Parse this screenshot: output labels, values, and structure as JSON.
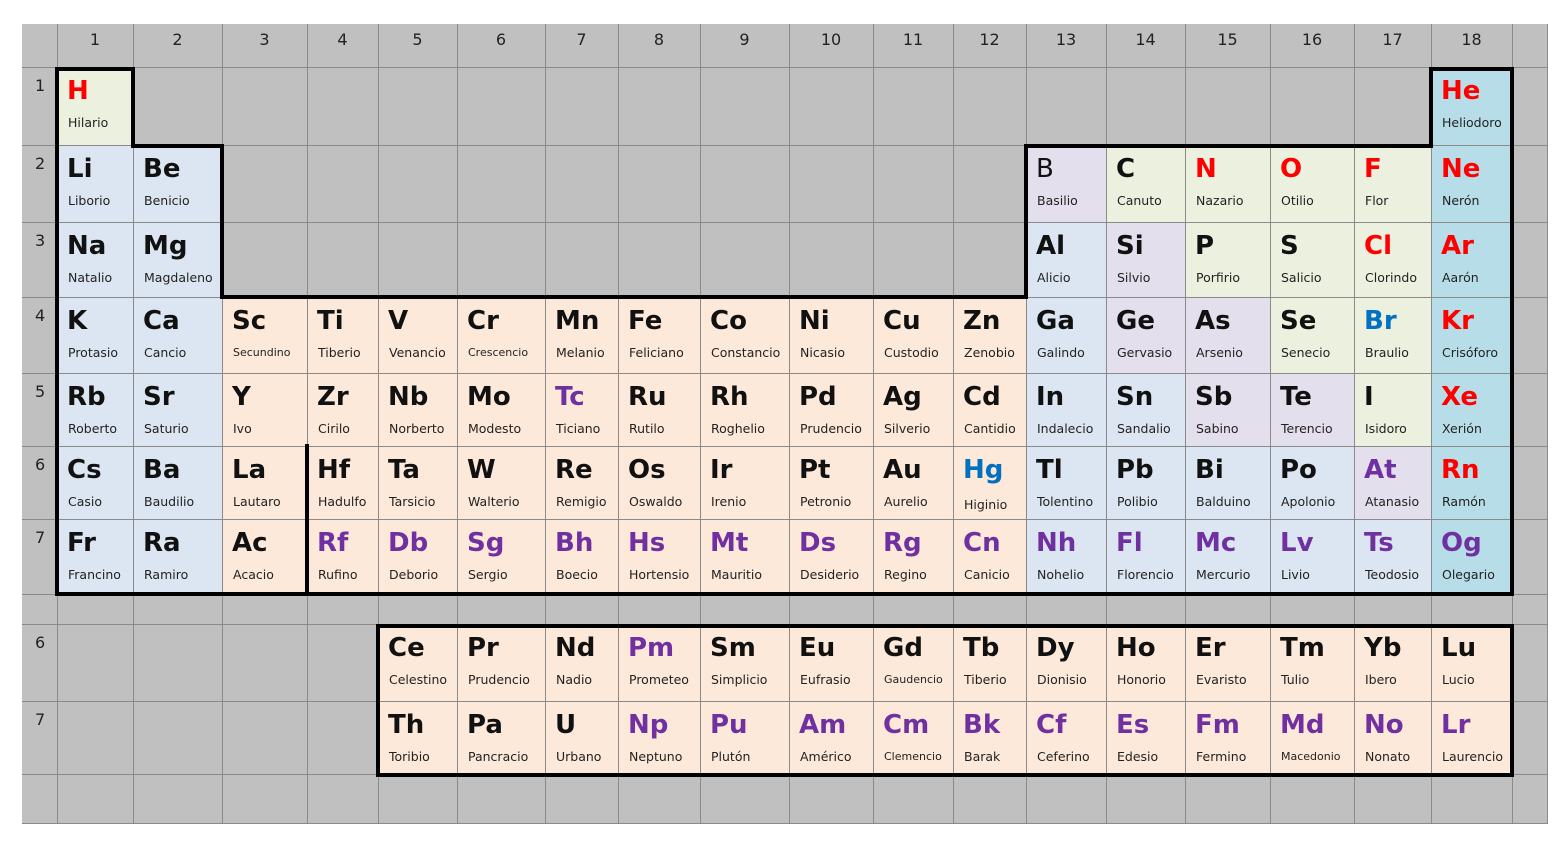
{
  "columns": [
    "1",
    "2",
    "3",
    "4",
    "5",
    "6",
    "7",
    "8",
    "9",
    "10",
    "11",
    "12",
    "13",
    "14",
    "15",
    "16",
    "17",
    "18"
  ],
  "periods": [
    "1",
    "2",
    "3",
    "4",
    "5",
    "6",
    "7"
  ],
  "series_periods": [
    "6",
    "7"
  ],
  "colors": {
    "grid": "#c0c0c0",
    "gridline": "#8a8a8a",
    "alkali": "#dce6f2",
    "transition": "#fde9d9",
    "post_transition": "#dce6f2",
    "metalloid": "#e4dfec",
    "nonmetal": "#ebf1de",
    "noble": "#b7dee8",
    "hydrogen": "#ebf1de",
    "gas_symbol": "#ff0000",
    "liquid_symbol": "#0070c0",
    "synthetic_symbol": "#7030a0"
  },
  "elements": [
    {
      "s": "H",
      "n": "Hilario",
      "r": 1,
      "c": 1,
      "bg": "nonmetal",
      "sc": "gas"
    },
    {
      "s": "He",
      "n": "Heliodoro",
      "r": 1,
      "c": 18,
      "bg": "noble",
      "sc": "gas"
    },
    {
      "s": "Li",
      "n": "Liborio",
      "r": 2,
      "c": 1,
      "bg": "alkali"
    },
    {
      "s": "Be",
      "n": "Benicio",
      "r": 2,
      "c": 2,
      "bg": "alkali"
    },
    {
      "s": "B",
      "n": "Basilio",
      "r": 2,
      "c": 13,
      "bg": "metalloid",
      "thin": true
    },
    {
      "s": "C",
      "n": "Canuto",
      "r": 2,
      "c": 14,
      "bg": "nonmetal"
    },
    {
      "s": "N",
      "n": "Nazario",
      "r": 2,
      "c": 15,
      "bg": "nonmetal",
      "sc": "gas"
    },
    {
      "s": "O",
      "n": "Otilio",
      "r": 2,
      "c": 16,
      "bg": "nonmetal",
      "sc": "gas"
    },
    {
      "s": "F",
      "n": "Flor",
      "r": 2,
      "c": 17,
      "bg": "nonmetal",
      "sc": "gas"
    },
    {
      "s": "Ne",
      "n": "Nerón",
      "r": 2,
      "c": 18,
      "bg": "noble",
      "sc": "gas"
    },
    {
      "s": "Na",
      "n": "Natalio",
      "r": 3,
      "c": 1,
      "bg": "alkali"
    },
    {
      "s": "Mg",
      "n": "Magdaleno",
      "r": 3,
      "c": 2,
      "bg": "alkali"
    },
    {
      "s": "Al",
      "n": "Alicio",
      "r": 3,
      "c": 13,
      "bg": "post_transition"
    },
    {
      "s": "Si",
      "n": "Silvio",
      "r": 3,
      "c": 14,
      "bg": "metalloid"
    },
    {
      "s": "P",
      "n": "Porfirio",
      "r": 3,
      "c": 15,
      "bg": "nonmetal"
    },
    {
      "s": "S",
      "n": "Salicio",
      "r": 3,
      "c": 16,
      "bg": "nonmetal"
    },
    {
      "s": "Cl",
      "n": "Clorindo",
      "r": 3,
      "c": 17,
      "bg": "nonmetal",
      "sc": "gas"
    },
    {
      "s": "Ar",
      "n": "Aarón",
      "r": 3,
      "c": 18,
      "bg": "noble",
      "sc": "gas"
    },
    {
      "s": "K",
      "n": "Protasio",
      "r": 4,
      "c": 1,
      "bg": "alkali"
    },
    {
      "s": "Ca",
      "n": "Cancio",
      "r": 4,
      "c": 2,
      "bg": "alkali"
    },
    {
      "s": "Sc",
      "n": "Secundino",
      "r": 4,
      "c": 3,
      "bg": "transition",
      "small": true
    },
    {
      "s": "Ti",
      "n": "Tiberio",
      "r": 4,
      "c": 4,
      "bg": "transition"
    },
    {
      "s": "V",
      "n": "Venancio",
      "r": 4,
      "c": 5,
      "bg": "transition"
    },
    {
      "s": "Cr",
      "n": "Crescencio",
      "r": 4,
      "c": 6,
      "bg": "transition",
      "small": true
    },
    {
      "s": "Mn",
      "n": "Melanio",
      "r": 4,
      "c": 7,
      "bg": "transition"
    },
    {
      "s": "Fe",
      "n": "Feliciano",
      "r": 4,
      "c": 8,
      "bg": "transition"
    },
    {
      "s": "Co",
      "n": "Constancio",
      "r": 4,
      "c": 9,
      "bg": "transition"
    },
    {
      "s": "Ni",
      "n": "Nicasio",
      "r": 4,
      "c": 10,
      "bg": "transition"
    },
    {
      "s": "Cu",
      "n": "Custodio",
      "r": 4,
      "c": 11,
      "bg": "transition"
    },
    {
      "s": "Zn",
      "n": "Zenobio",
      "r": 4,
      "c": 12,
      "bg": "transition"
    },
    {
      "s": "Ga",
      "n": "Galindo",
      "r": 4,
      "c": 13,
      "bg": "post_transition"
    },
    {
      "s": "Ge",
      "n": "Gervasio",
      "r": 4,
      "c": 14,
      "bg": "metalloid"
    },
    {
      "s": "As",
      "n": "Arsenio",
      "r": 4,
      "c": 15,
      "bg": "metalloid"
    },
    {
      "s": "Se",
      "n": "Senecio",
      "r": 4,
      "c": 16,
      "bg": "nonmetal"
    },
    {
      "s": "Br",
      "n": "Braulio",
      "r": 4,
      "c": 17,
      "bg": "nonmetal",
      "sc": "liquid"
    },
    {
      "s": "Kr",
      "n": "Crisóforo",
      "r": 4,
      "c": 18,
      "bg": "noble",
      "sc": "gas"
    },
    {
      "s": "Rb",
      "n": "Roberto",
      "r": 5,
      "c": 1,
      "bg": "alkali"
    },
    {
      "s": "Sr",
      "n": "Saturio",
      "r": 5,
      "c": 2,
      "bg": "alkali"
    },
    {
      "s": "Y",
      "n": "Ivo",
      "r": 5,
      "c": 3,
      "bg": "transition"
    },
    {
      "s": "Zr",
      "n": "Cirilo",
      "r": 5,
      "c": 4,
      "bg": "transition"
    },
    {
      "s": "Nb",
      "n": "Norberto",
      "r": 5,
      "c": 5,
      "bg": "transition"
    },
    {
      "s": "Mo",
      "n": "Modesto",
      "r": 5,
      "c": 6,
      "bg": "transition"
    },
    {
      "s": "Tc",
      "n": "Ticiano",
      "r": 5,
      "c": 7,
      "bg": "transition",
      "sc": "synthetic"
    },
    {
      "s": "Ru",
      "n": "Rutilo",
      "r": 5,
      "c": 8,
      "bg": "transition"
    },
    {
      "s": "Rh",
      "n": "Roghelio",
      "r": 5,
      "c": 9,
      "bg": "transition"
    },
    {
      "s": "Pd",
      "n": "Prudencio",
      "r": 5,
      "c": 10,
      "bg": "transition"
    },
    {
      "s": "Ag",
      "n": "Silverio",
      "r": 5,
      "c": 11,
      "bg": "transition"
    },
    {
      "s": "Cd",
      "n": "Cantidio",
      "r": 5,
      "c": 12,
      "bg": "transition"
    },
    {
      "s": "In",
      "n": "Indalecio",
      "r": 5,
      "c": 13,
      "bg": "post_transition"
    },
    {
      "s": "Sn",
      "n": "Sandalio",
      "r": 5,
      "c": 14,
      "bg": "post_transition"
    },
    {
      "s": "Sb",
      "n": "Sabino",
      "r": 5,
      "c": 15,
      "bg": "metalloid"
    },
    {
      "s": "Te",
      "n": "Terencio",
      "r": 5,
      "c": 16,
      "bg": "metalloid"
    },
    {
      "s": "I",
      "n": "Isidoro",
      "r": 5,
      "c": 17,
      "bg": "nonmetal"
    },
    {
      "s": "Xe",
      "n": "Xerión",
      "r": 5,
      "c": 18,
      "bg": "noble",
      "sc": "gas"
    },
    {
      "s": "Cs",
      "n": "Casio",
      "r": 6,
      "c": 1,
      "bg": "alkali"
    },
    {
      "s": "Ba",
      "n": "Baudilio",
      "r": 6,
      "c": 2,
      "bg": "alkali"
    },
    {
      "s": "La",
      "n": "Lautaro",
      "r": 6,
      "c": 3,
      "bg": "transition"
    },
    {
      "s": "Hf",
      "n": "Hadulfo",
      "r": 6,
      "c": 4,
      "bg": "transition"
    },
    {
      "s": "Ta",
      "n": "Tarsicio",
      "r": 6,
      "c": 5,
      "bg": "transition"
    },
    {
      "s": "W",
      "n": "Walterio",
      "r": 6,
      "c": 6,
      "bg": "transition"
    },
    {
      "s": "Re",
      "n": "Remigio",
      "r": 6,
      "c": 7,
      "bg": "transition"
    },
    {
      "s": "Os",
      "n": "Oswaldo",
      "r": 6,
      "c": 8,
      "bg": "transition"
    },
    {
      "s": "Ir",
      "n": "Irenio",
      "r": 6,
      "c": 9,
      "bg": "transition"
    },
    {
      "s": "Pt",
      "n": "Petronio",
      "r": 6,
      "c": 10,
      "bg": "transition"
    },
    {
      "s": "Au",
      "n": "Aurelio",
      "r": 6,
      "c": 11,
      "bg": "transition"
    },
    {
      "s": "Hg",
      "n": "Higinio",
      "r": 6,
      "c": 12,
      "bg": "transition",
      "sc": "liquid",
      "low": true
    },
    {
      "s": "Tl",
      "n": "Tolentino",
      "r": 6,
      "c": 13,
      "bg": "post_transition"
    },
    {
      "s": "Pb",
      "n": "Polibio",
      "r": 6,
      "c": 14,
      "bg": "post_transition"
    },
    {
      "s": "Bi",
      "n": "Balduino",
      "r": 6,
      "c": 15,
      "bg": "post_transition"
    },
    {
      "s": "Po",
      "n": "Apolonio",
      "r": 6,
      "c": 16,
      "bg": "post_transition"
    },
    {
      "s": "At",
      "n": "Atanasio",
      "r": 6,
      "c": 17,
      "bg": "metalloid",
      "sc": "synthetic"
    },
    {
      "s": "Rn",
      "n": "Ramón",
      "r": 6,
      "c": 18,
      "bg": "noble",
      "sc": "gas"
    },
    {
      "s": "Fr",
      "n": "Francino",
      "r": 7,
      "c": 1,
      "bg": "alkali"
    },
    {
      "s": "Ra",
      "n": "Ramiro",
      "r": 7,
      "c": 2,
      "bg": "alkali"
    },
    {
      "s": "Ac",
      "n": "Acacio",
      "r": 7,
      "c": 3,
      "bg": "transition"
    },
    {
      "s": "Rf",
      "n": "Rufino",
      "r": 7,
      "c": 4,
      "bg": "transition",
      "sc": "synthetic"
    },
    {
      "s": "Db",
      "n": "Deborio",
      "r": 7,
      "c": 5,
      "bg": "transition",
      "sc": "synthetic"
    },
    {
      "s": "Sg",
      "n": "Sergio",
      "r": 7,
      "c": 6,
      "bg": "transition",
      "sc": "synthetic"
    },
    {
      "s": "Bh",
      "n": "Boecio",
      "r": 7,
      "c": 7,
      "bg": "transition",
      "sc": "synthetic"
    },
    {
      "s": "Hs",
      "n": "Hortensio",
      "r": 7,
      "c": 8,
      "bg": "transition",
      "sc": "synthetic"
    },
    {
      "s": "Mt",
      "n": "Mauritio",
      "r": 7,
      "c": 9,
      "bg": "transition",
      "sc": "synthetic"
    },
    {
      "s": "Ds",
      "n": "Desiderio",
      "r": 7,
      "c": 10,
      "bg": "transition",
      "sc": "synthetic"
    },
    {
      "s": "Rg",
      "n": "Regino",
      "r": 7,
      "c": 11,
      "bg": "transition",
      "sc": "synthetic"
    },
    {
      "s": "Cn",
      "n": "Canicio",
      "r": 7,
      "c": 12,
      "bg": "transition",
      "sc": "synthetic"
    },
    {
      "s": "Nh",
      "n": "Nohelio",
      "r": 7,
      "c": 13,
      "bg": "post_transition",
      "sc": "synthetic"
    },
    {
      "s": "Fl",
      "n": "Florencio",
      "r": 7,
      "c": 14,
      "bg": "post_transition",
      "sc": "synthetic"
    },
    {
      "s": "Mc",
      "n": "Mercurio",
      "r": 7,
      "c": 15,
      "bg": "post_transition",
      "sc": "synthetic"
    },
    {
      "s": "Lv",
      "n": "Livio",
      "r": 7,
      "c": 16,
      "bg": "post_transition",
      "sc": "synthetic"
    },
    {
      "s": "Ts",
      "n": "Teodosio",
      "r": 7,
      "c": 17,
      "bg": "post_transition",
      "sc": "synthetic"
    },
    {
      "s": "Og",
      "n": "Olegario",
      "r": 7,
      "c": 18,
      "bg": "noble",
      "sc": "synthetic"
    },
    {
      "s": "Ce",
      "n": "Celestino",
      "r": 9,
      "c": 5,
      "bg": "transition"
    },
    {
      "s": "Pr",
      "n": "Prudencio",
      "r": 9,
      "c": 6,
      "bg": "transition"
    },
    {
      "s": "Nd",
      "n": "Nadio",
      "r": 9,
      "c": 7,
      "bg": "transition"
    },
    {
      "s": "Pm",
      "n": "Prometeo",
      "r": 9,
      "c": 8,
      "bg": "transition",
      "sc": "synthetic"
    },
    {
      "s": "Sm",
      "n": "Simplicio",
      "r": 9,
      "c": 9,
      "bg": "transition"
    },
    {
      "s": "Eu",
      "n": "Eufrasio",
      "r": 9,
      "c": 10,
      "bg": "transition"
    },
    {
      "s": "Gd",
      "n": "Gaudencio",
      "r": 9,
      "c": 11,
      "bg": "transition",
      "small": true
    },
    {
      "s": "Tb",
      "n": "Tiberio",
      "r": 9,
      "c": 12,
      "bg": "transition"
    },
    {
      "s": "Dy",
      "n": "Dionisio",
      "r": 9,
      "c": 13,
      "bg": "transition"
    },
    {
      "s": "Ho",
      "n": "Honorio",
      "r": 9,
      "c": 14,
      "bg": "transition"
    },
    {
      "s": "Er",
      "n": "Evaristo",
      "r": 9,
      "c": 15,
      "bg": "transition"
    },
    {
      "s": "Tm",
      "n": "Tulio",
      "r": 9,
      "c": 16,
      "bg": "transition"
    },
    {
      "s": "Yb",
      "n": "Ibero",
      "r": 9,
      "c": 17,
      "bg": "transition"
    },
    {
      "s": "Lu",
      "n": "Lucio",
      "r": 9,
      "c": 18,
      "bg": "transition"
    },
    {
      "s": "Th",
      "n": "Toribio",
      "r": 10,
      "c": 5,
      "bg": "transition"
    },
    {
      "s": "Pa",
      "n": "Pancracio",
      "r": 10,
      "c": 6,
      "bg": "transition"
    },
    {
      "s": "U",
      "n": "Urbano",
      "r": 10,
      "c": 7,
      "bg": "transition"
    },
    {
      "s": "Np",
      "n": "Neptuno",
      "r": 10,
      "c": 8,
      "bg": "transition",
      "sc": "synthetic"
    },
    {
      "s": "Pu",
      "n": "Plutón",
      "r": 10,
      "c": 9,
      "bg": "transition",
      "sc": "synthetic"
    },
    {
      "s": "Am",
      "n": "Américo",
      "r": 10,
      "c": 10,
      "bg": "transition",
      "sc": "synthetic"
    },
    {
      "s": "Cm",
      "n": "Clemencio",
      "r": 10,
      "c": 11,
      "bg": "transition",
      "sc": "synthetic",
      "small": true
    },
    {
      "s": "Bk",
      "n": "Barak",
      "r": 10,
      "c": 12,
      "bg": "transition",
      "sc": "synthetic"
    },
    {
      "s": "Cf",
      "n": "Ceferino",
      "r": 10,
      "c": 13,
      "bg": "transition",
      "sc": "synthetic"
    },
    {
      "s": "Es",
      "n": "Edesio",
      "r": 10,
      "c": 14,
      "bg": "transition",
      "sc": "synthetic"
    },
    {
      "s": "Fm",
      "n": "Fermino",
      "r": 10,
      "c": 15,
      "bg": "transition",
      "sc": "synthetic"
    },
    {
      "s": "Md",
      "n": "Macedonio",
      "r": 10,
      "c": 16,
      "bg": "transition",
      "sc": "synthetic",
      "small": true
    },
    {
      "s": "No",
      "n": "Nonato",
      "r": 10,
      "c": 17,
      "bg": "transition",
      "sc": "synthetic"
    },
    {
      "s": "Lr",
      "n": "Laurencio",
      "r": 10,
      "c": 18,
      "bg": "transition",
      "sc": "synthetic"
    }
  ]
}
